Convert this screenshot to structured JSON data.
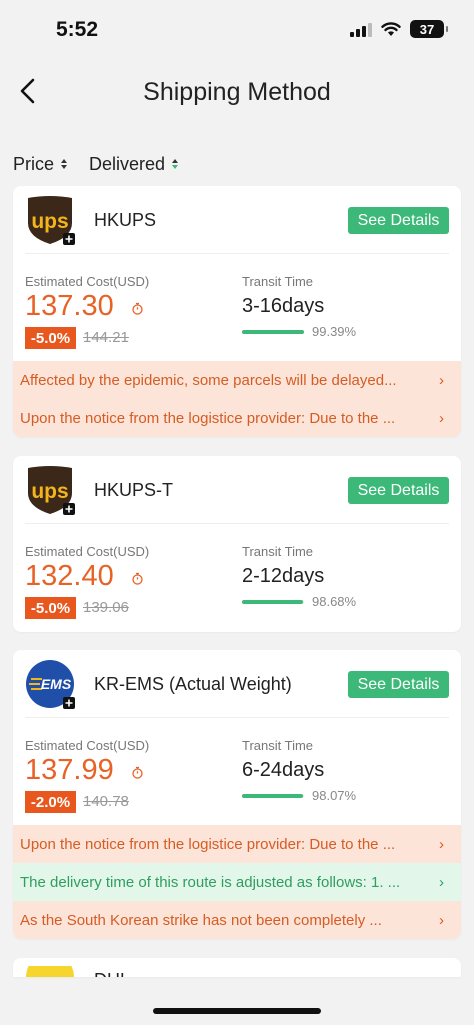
{
  "status": {
    "time": "5:52",
    "battery": "37"
  },
  "nav": {
    "title": "Shipping Method"
  },
  "sort": {
    "price_label": "Price",
    "delivered_label": "Delivered"
  },
  "common": {
    "cost_label": "Estimated Cost(USD)",
    "transit_label": "Transit Time",
    "details_label": "See Details"
  },
  "colors": {
    "accent_green": "#3cb878",
    "price_orange": "#e86226",
    "ups_brown": "#3b2818",
    "ups_gold": "#f4b51c",
    "ems_blue": "#1f4fa8"
  },
  "cards": [
    {
      "carrier": "HKUPS",
      "logo": "ups-logo",
      "price": "137.30",
      "discount": "-5.0%",
      "original_price": "144.21",
      "transit_days": "3-16days",
      "rate": "99.39%",
      "rate_value": 0.9939,
      "notices": [
        {
          "text": "Affected by the epidemic, some parcels will be delayed...",
          "tone": "orange"
        },
        {
          "text": "Upon the notice from the logistice provider: Due to the ...",
          "tone": "orange"
        }
      ]
    },
    {
      "carrier": "HKUPS-T",
      "logo": "ups-logo",
      "price": "132.40",
      "discount": "-5.0%",
      "original_price": "139.06",
      "transit_days": "2-12days",
      "rate": "98.68%",
      "rate_value": 0.9868,
      "notices": []
    },
    {
      "carrier": "KR-EMS (Actual Weight)",
      "logo": "ems-logo",
      "price": "137.99",
      "discount": "-2.0%",
      "original_price": "140.78",
      "transit_days": "6-24days",
      "rate": "98.07%",
      "rate_value": 0.9807,
      "notices": [
        {
          "text": "Upon the notice from the logistice provider: Due to the ...",
          "tone": "orange"
        },
        {
          "text": "The delivery time of this route is adjusted as follows: 1. ...",
          "tone": "green"
        },
        {
          "text": "As the South Korean strike has not been completely ...",
          "tone": "orange"
        }
      ]
    },
    {
      "carrier": "DHL",
      "logo": "dhl-logo"
    }
  ]
}
